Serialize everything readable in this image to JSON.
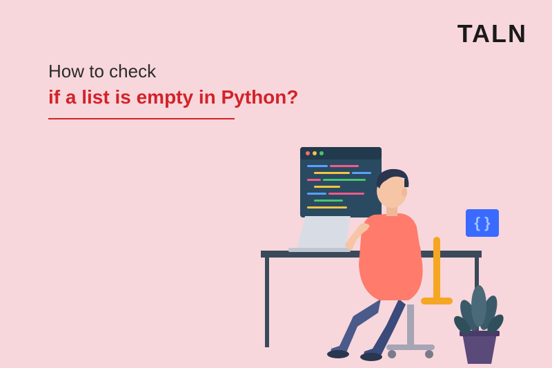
{
  "brand": {
    "logo_text": "TALN"
  },
  "heading": {
    "line1": "How to check",
    "line2": "if a list is empty in Python?"
  },
  "illustration": {
    "braces_symbol": "{ }",
    "colors": {
      "monitor_bg": "#2a4a61",
      "desk": "#3b4a5a",
      "shirt": "#ff7b6b",
      "pants": "#4a5a8a",
      "hair": "#2a3550",
      "skin": "#f5c5a5",
      "laptop": "#d8dce5",
      "chair": "#f5a623",
      "plant_pot": "#5a4a7a",
      "plant_leaves": "#3a5a6a",
      "braces_badge": "#3a6aff"
    }
  }
}
